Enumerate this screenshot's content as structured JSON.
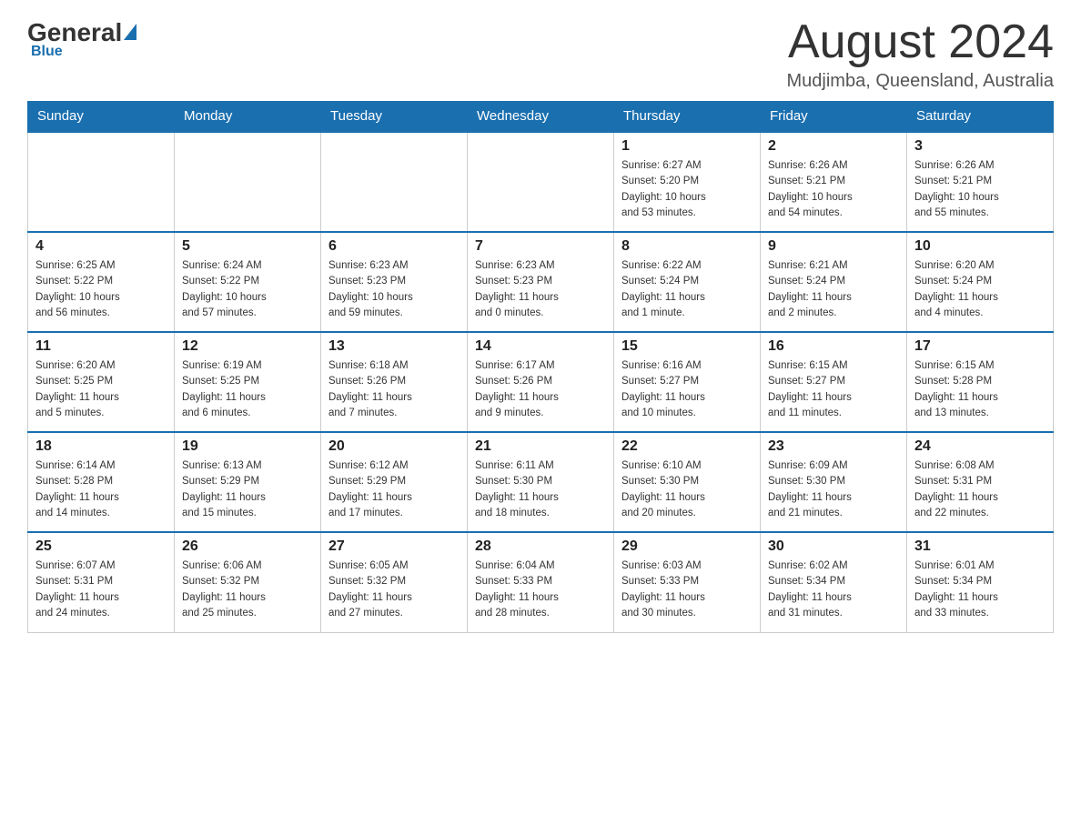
{
  "header": {
    "logo_general": "General",
    "logo_blue": "Blue",
    "month_title": "August 2024",
    "location": "Mudjimba, Queensland, Australia"
  },
  "days_of_week": [
    "Sunday",
    "Monday",
    "Tuesday",
    "Wednesday",
    "Thursday",
    "Friday",
    "Saturday"
  ],
  "weeks": [
    [
      {
        "day": "",
        "info": ""
      },
      {
        "day": "",
        "info": ""
      },
      {
        "day": "",
        "info": ""
      },
      {
        "day": "",
        "info": ""
      },
      {
        "day": "1",
        "info": "Sunrise: 6:27 AM\nSunset: 5:20 PM\nDaylight: 10 hours\nand 53 minutes."
      },
      {
        "day": "2",
        "info": "Sunrise: 6:26 AM\nSunset: 5:21 PM\nDaylight: 10 hours\nand 54 minutes."
      },
      {
        "day": "3",
        "info": "Sunrise: 6:26 AM\nSunset: 5:21 PM\nDaylight: 10 hours\nand 55 minutes."
      }
    ],
    [
      {
        "day": "4",
        "info": "Sunrise: 6:25 AM\nSunset: 5:22 PM\nDaylight: 10 hours\nand 56 minutes."
      },
      {
        "day": "5",
        "info": "Sunrise: 6:24 AM\nSunset: 5:22 PM\nDaylight: 10 hours\nand 57 minutes."
      },
      {
        "day": "6",
        "info": "Sunrise: 6:23 AM\nSunset: 5:23 PM\nDaylight: 10 hours\nand 59 minutes."
      },
      {
        "day": "7",
        "info": "Sunrise: 6:23 AM\nSunset: 5:23 PM\nDaylight: 11 hours\nand 0 minutes."
      },
      {
        "day": "8",
        "info": "Sunrise: 6:22 AM\nSunset: 5:24 PM\nDaylight: 11 hours\nand 1 minute."
      },
      {
        "day": "9",
        "info": "Sunrise: 6:21 AM\nSunset: 5:24 PM\nDaylight: 11 hours\nand 2 minutes."
      },
      {
        "day": "10",
        "info": "Sunrise: 6:20 AM\nSunset: 5:24 PM\nDaylight: 11 hours\nand 4 minutes."
      }
    ],
    [
      {
        "day": "11",
        "info": "Sunrise: 6:20 AM\nSunset: 5:25 PM\nDaylight: 11 hours\nand 5 minutes."
      },
      {
        "day": "12",
        "info": "Sunrise: 6:19 AM\nSunset: 5:25 PM\nDaylight: 11 hours\nand 6 minutes."
      },
      {
        "day": "13",
        "info": "Sunrise: 6:18 AM\nSunset: 5:26 PM\nDaylight: 11 hours\nand 7 minutes."
      },
      {
        "day": "14",
        "info": "Sunrise: 6:17 AM\nSunset: 5:26 PM\nDaylight: 11 hours\nand 9 minutes."
      },
      {
        "day": "15",
        "info": "Sunrise: 6:16 AM\nSunset: 5:27 PM\nDaylight: 11 hours\nand 10 minutes."
      },
      {
        "day": "16",
        "info": "Sunrise: 6:15 AM\nSunset: 5:27 PM\nDaylight: 11 hours\nand 11 minutes."
      },
      {
        "day": "17",
        "info": "Sunrise: 6:15 AM\nSunset: 5:28 PM\nDaylight: 11 hours\nand 13 minutes."
      }
    ],
    [
      {
        "day": "18",
        "info": "Sunrise: 6:14 AM\nSunset: 5:28 PM\nDaylight: 11 hours\nand 14 minutes."
      },
      {
        "day": "19",
        "info": "Sunrise: 6:13 AM\nSunset: 5:29 PM\nDaylight: 11 hours\nand 15 minutes."
      },
      {
        "day": "20",
        "info": "Sunrise: 6:12 AM\nSunset: 5:29 PM\nDaylight: 11 hours\nand 17 minutes."
      },
      {
        "day": "21",
        "info": "Sunrise: 6:11 AM\nSunset: 5:30 PM\nDaylight: 11 hours\nand 18 minutes."
      },
      {
        "day": "22",
        "info": "Sunrise: 6:10 AM\nSunset: 5:30 PM\nDaylight: 11 hours\nand 20 minutes."
      },
      {
        "day": "23",
        "info": "Sunrise: 6:09 AM\nSunset: 5:30 PM\nDaylight: 11 hours\nand 21 minutes."
      },
      {
        "day": "24",
        "info": "Sunrise: 6:08 AM\nSunset: 5:31 PM\nDaylight: 11 hours\nand 22 minutes."
      }
    ],
    [
      {
        "day": "25",
        "info": "Sunrise: 6:07 AM\nSunset: 5:31 PM\nDaylight: 11 hours\nand 24 minutes."
      },
      {
        "day": "26",
        "info": "Sunrise: 6:06 AM\nSunset: 5:32 PM\nDaylight: 11 hours\nand 25 minutes."
      },
      {
        "day": "27",
        "info": "Sunrise: 6:05 AM\nSunset: 5:32 PM\nDaylight: 11 hours\nand 27 minutes."
      },
      {
        "day": "28",
        "info": "Sunrise: 6:04 AM\nSunset: 5:33 PM\nDaylight: 11 hours\nand 28 minutes."
      },
      {
        "day": "29",
        "info": "Sunrise: 6:03 AM\nSunset: 5:33 PM\nDaylight: 11 hours\nand 30 minutes."
      },
      {
        "day": "30",
        "info": "Sunrise: 6:02 AM\nSunset: 5:34 PM\nDaylight: 11 hours\nand 31 minutes."
      },
      {
        "day": "31",
        "info": "Sunrise: 6:01 AM\nSunset: 5:34 PM\nDaylight: 11 hours\nand 33 minutes."
      }
    ]
  ]
}
